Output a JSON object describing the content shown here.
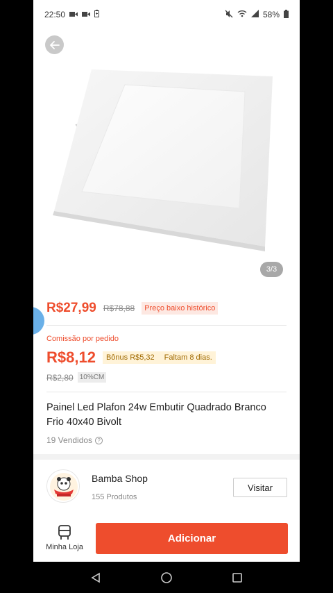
{
  "status_bar": {
    "time": "22:50",
    "battery": "58%",
    "left_icons": [
      "video-camera-icon",
      "video-camera-icon",
      "battery-saver-icon"
    ],
    "right_icons": [
      "mute-icon",
      "wifi-icon",
      "signal-icon",
      "battery-icon"
    ]
  },
  "product": {
    "image_counter": "3/3",
    "price": "R$27,99",
    "old_price": "R$78,88",
    "price_badge": "Preço baixo histórico",
    "commission_label": "Comissão por pedido",
    "commission_value": "R$8,12",
    "bonus_text": "Bônus R$5,32",
    "bonus_deadline": "Faltam 8 dias.",
    "old_commission": "R$2,80",
    "commission_pct": "10%CM",
    "title": "Painel Led Plafon 24w Embutir Quadrado Branco Frio 40x40 Bivolt",
    "sold": "19 Vendidos"
  },
  "shop": {
    "name": "Bamba Shop",
    "product_count": "155 Produtos",
    "visit_label": "Visitar"
  },
  "bottom_bar": {
    "store_label": "Minha Loja",
    "add_label": "Adicionar"
  },
  "colors": {
    "accent": "#ee4d2d",
    "bonus_bg": "#fff3d8",
    "badge_bg": "#fde8e2"
  }
}
